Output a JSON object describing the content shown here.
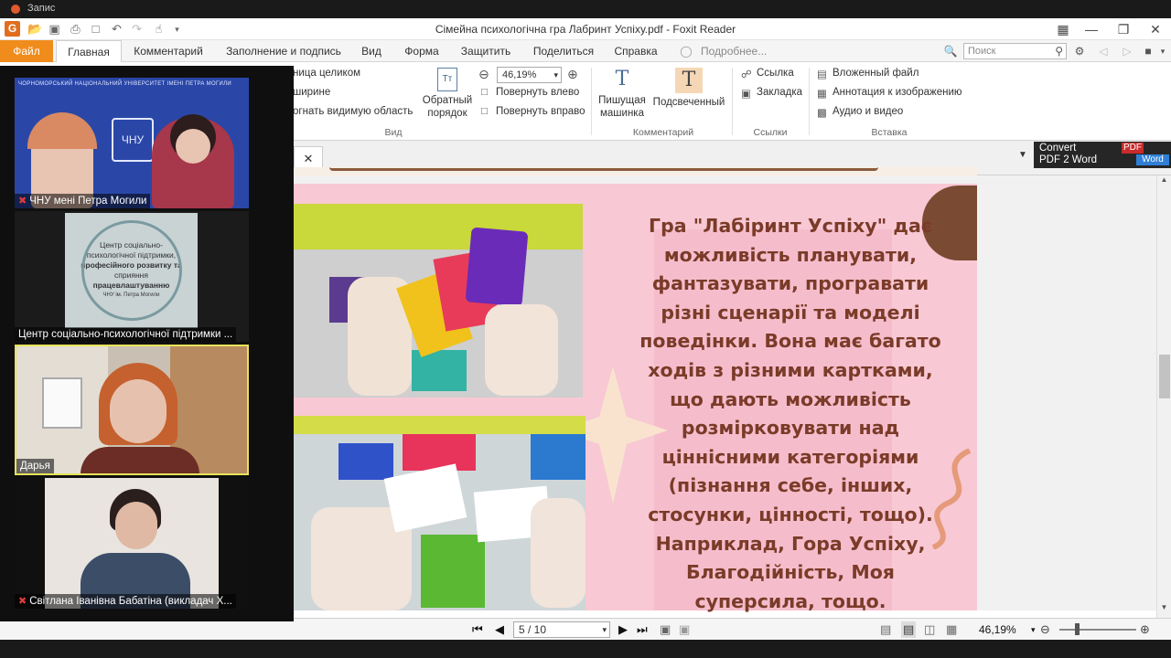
{
  "recorder": {
    "label": "Запис"
  },
  "window": {
    "title": "Сімейна психологічна гра Лабринт Успіху.pdf - Foxit Reader"
  },
  "menu": {
    "tabs": [
      "Файл",
      "Главная",
      "Комментарий",
      "Заполнение и подпись",
      "Вид",
      "Форма",
      "Защитить",
      "Поделиться",
      "Справка"
    ],
    "help_search": "Подробнее...",
    "search_placeholder": "Поиск"
  },
  "ribbon": {
    "view": {
      "fit_page": "ница целиком",
      "fit_width": "ширине",
      "fit_visible": "огнать видимую область",
      "reverse_order_line1": "Обратный",
      "reverse_order_line2": "порядок",
      "zoom_value": "46,19%",
      "rotate_left": "Повернуть влево",
      "rotate_right": "Повернуть вправо",
      "group_label": "Вид"
    },
    "comments": {
      "typewriter_line1": "Пишущая",
      "typewriter_line2": "машинка",
      "highlight": "Подсвеченный",
      "group_label": "Комментарий"
    },
    "links": {
      "link": "Ссылка",
      "bookmark": "Закладка",
      "group_label": "Ссылки"
    },
    "insert": {
      "attached_file": "Вложенный файл",
      "image_annotation": "Аннотация к изображению",
      "audio_video": "Аудио и видео",
      "group_label": "Вставка"
    }
  },
  "convert_banner": {
    "line1": "Convert",
    "line2": "PDF 2 Word",
    "badge_pdf": "PDF",
    "badge_word": "Word"
  },
  "document": {
    "slide_text_lines": [
      "Гра \"Лабіринт Успіху\" дає",
      "можливість планувати,",
      "фантазувати, програвати",
      "різні сценарії та моделі",
      "поведінки. Вона має багато",
      "ходів з різними картками,",
      "що дають можливість",
      "розмірковувати над",
      "ціннісними категоріями",
      "(пізнання себе, інших,",
      "стосунки, цінності, тощо).",
      "Наприклад, Гора Успіху,",
      "Благодійність, Моя",
      "суперсила, тощо."
    ]
  },
  "statusbar": {
    "page_indicator": "5 / 10",
    "zoom": "46,19%"
  },
  "participants": [
    {
      "name": "ЧНУ мені Петра Могили",
      "muted": true,
      "background_text": "ЧОРНОМОРСЬКИЙ НАЦІОНАЛЬНИЙ УНІВЕРСИТЕТ ІМЕНІ ПЕТРА МОГИЛИ",
      "logo_text": "ЧНУ"
    },
    {
      "name": "Центр соціально-психологічної підтримки ...",
      "muted": false,
      "logo_line1": "Центр соціально-",
      "logo_line2": "психологічної підтримки,",
      "logo_line3": "професійного розвитку та",
      "logo_line4": "сприяння",
      "logo_line5": "працевлаштуванню",
      "logo_line6": "ЧНУ ім. Петра Могили"
    },
    {
      "name": "Дарья",
      "muted": false,
      "active_speaker": true
    },
    {
      "name": "Світлана Іванівна Бабатіна  (викладач Х...",
      "muted": true
    }
  ],
  "colors": {
    "accent": "#f08c1c",
    "page_bg": "#f8c8d4",
    "slide_text": "#7a3b28",
    "speaker_border": "#e7e35a"
  }
}
